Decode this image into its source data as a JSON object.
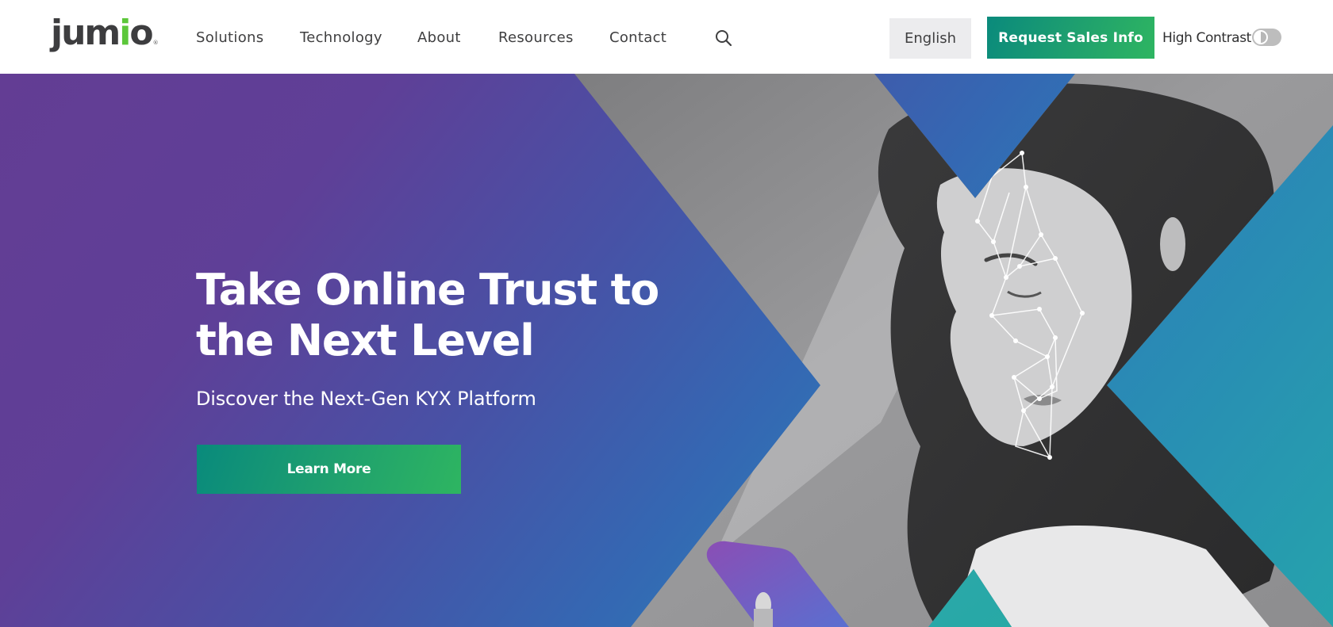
{
  "header": {
    "logo": {
      "text_before": "jum",
      "text_i": "i",
      "text_after": "o",
      "registered": "®",
      "accent_color": "#5cc73a"
    },
    "nav": [
      {
        "label": "Solutions"
      },
      {
        "label": "Technology"
      },
      {
        "label": "About"
      },
      {
        "label": "Resources"
      },
      {
        "label": "Contact"
      }
    ],
    "search_icon": "search-icon",
    "language_label": "English",
    "cta_label": "Request Sales Info",
    "high_contrast_label": "High Contrast",
    "high_contrast_enabled": false
  },
  "hero": {
    "title": "Take Online Trust to the Next Level",
    "subtitle": "Discover the Next-Gen KYX Platform",
    "button_label": "Learn More",
    "image_description": "Woman looking at a purple phone with facial recognition mesh overlay, shown inside an X shape",
    "colors": {
      "gradient_start": "#633d94",
      "gradient_mid": "#3468b3",
      "gradient_end": "#25a3ac",
      "button_start": "#098a7c",
      "button_end": "#2eb561"
    }
  }
}
